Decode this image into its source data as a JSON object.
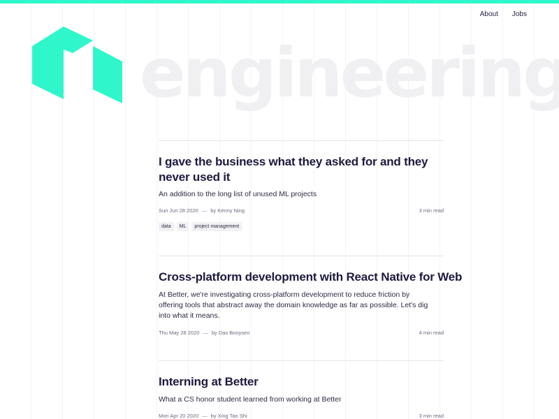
{
  "nav": {
    "items": [
      "About",
      "Jobs"
    ]
  },
  "brand": {
    "word": "engineering"
  },
  "colors": {
    "accent": "#2ff7cb",
    "text": "#1d1a3e",
    "muted": "#6a6a80"
  },
  "posts": [
    {
      "title": "I gave the business what they asked for and they never used it",
      "subtitle": "An addition to the long list of unused ML projects",
      "date": "Sun Jun 28 2020",
      "sep": "—",
      "author": "by Kenny Ning",
      "read": "3 min read",
      "tags": [
        "data",
        "ML",
        "project management"
      ]
    },
    {
      "title": "Cross-platform development with React Native for Web",
      "subtitle": "At Better, we're investigating cross-platform development to reduce friction by offering tools that abstract away the domain knowledge as far as possible. Let's dig into what it means.",
      "date": "Thu May 28 2020",
      "sep": "—",
      "author": "by Dax Booysen",
      "read": "4 min read"
    },
    {
      "title": "Interning at Better",
      "subtitle": "What a CS honor student learned from working at Better",
      "date": "Mon Apr 20 2020",
      "sep": "—",
      "author": "by Xing Tao Shi",
      "read": "3 min read"
    }
  ]
}
